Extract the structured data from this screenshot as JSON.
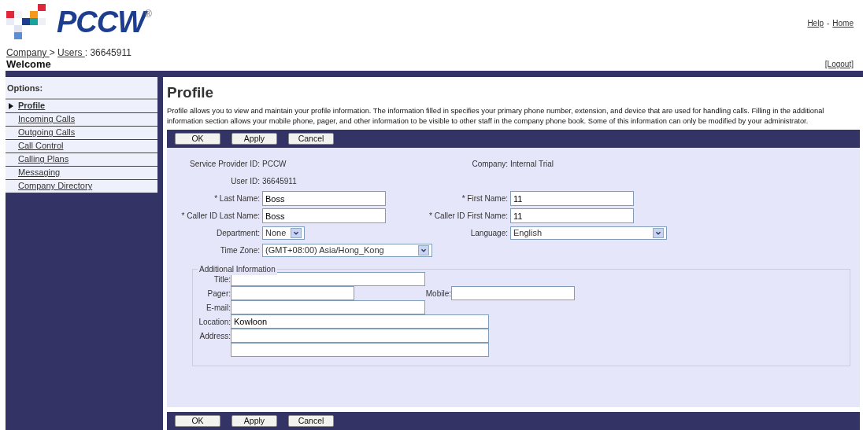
{
  "logo": {
    "text": "PCCW",
    "mark": "®"
  },
  "header_links": [
    "Help",
    "-",
    "Home"
  ],
  "breadcrumb": [
    {
      "text": "Company ",
      "kind": "link"
    },
    {
      "text": " > ",
      "kind": "text"
    },
    {
      "text": "Users ",
      "kind": "link"
    },
    {
      "text": ": 36645911",
      "kind": "text"
    }
  ],
  "welcome": "Welcome",
  "logout": "[Logout]",
  "sidebar": {
    "title": "Options:",
    "items": [
      {
        "label": "Profile",
        "selected": true
      },
      {
        "label": "Incoming Calls",
        "selected": false
      },
      {
        "label": "Outgoing Calls",
        "selected": false
      },
      {
        "label": "Call Control",
        "selected": false
      },
      {
        "label": "Calling Plans",
        "selected": false
      },
      {
        "label": "Messaging",
        "selected": false
      },
      {
        "label": "Company Directory",
        "selected": false
      }
    ]
  },
  "page_title": "Profile",
  "description": "Profile allows you to view and maintain your profile information. The information filled in specifies your primary phone number, extension, and device that are used for handling calls. Filling in the additional information section allows your mobile phone, pager, and other information to be visible to other staff in the company phone book. Some of this information can only be modified by your administrator.",
  "toolbar_top": [
    "OK",
    "Apply",
    "Cancel"
  ],
  "info_rows": [
    [
      {
        "kind": "info",
        "label": "Service Provider ID:",
        "value": "PCCW"
      },
      {
        "kind": "info",
        "label": "Company:",
        "value": "Internal Trial"
      }
    ],
    [
      {
        "kind": "info",
        "label": "User ID:",
        "value": "36645911"
      }
    ],
    [
      {
        "kind": "text",
        "label": "* Last Name:",
        "value": "Boss"
      },
      {
        "kind": "text",
        "label": "* First Name:",
        "value": "11"
      }
    ],
    [
      {
        "kind": "text",
        "label": "* Caller ID Last Name:",
        "value": "Boss"
      },
      {
        "kind": "text",
        "label": "* Caller ID First Name:",
        "value": "11"
      }
    ],
    [
      {
        "kind": "select",
        "label": "Department:",
        "value": "None"
      },
      {
        "kind": "select",
        "label": "Language:",
        "value": "English"
      }
    ],
    [
      {
        "kind": "select",
        "label": "Time Zone:",
        "value": "(GMT+08:00) Asia/Hong_Kong"
      }
    ]
  ],
  "additional": {
    "legend": "Additional Information",
    "rows": [
      [
        {
          "label": "Title:"
        }
      ],
      [
        {
          "label": "Pager:"
        },
        {
          "label": "Mobile:"
        }
      ],
      [
        {
          "label": "E-mail:"
        }
      ],
      [
        {
          "label": "Location:",
          "value": "Kowloon"
        }
      ],
      [
        {
          "label": "Address:"
        }
      ],
      [
        {}
      ]
    ]
  },
  "toolbar_bottom": [
    "OK",
    "Apply",
    "Cancel"
  ]
}
